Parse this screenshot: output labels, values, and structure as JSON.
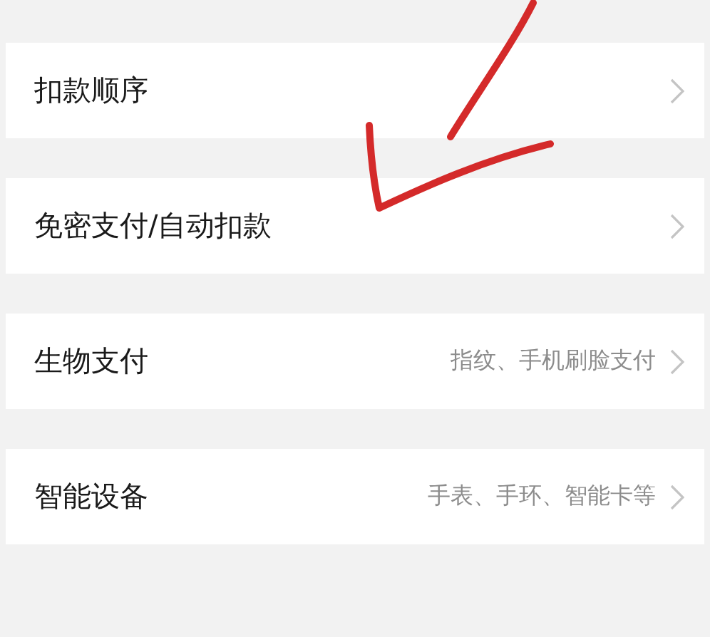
{
  "settings": [
    {
      "label": "扣款顺序"
    },
    {
      "label": "免密支付/自动扣款"
    },
    {
      "label": "生物支付",
      "detail": "指纹、手机刷脸支付"
    },
    {
      "label": "智能设备",
      "detail": "手表、手环、智能卡等"
    }
  ],
  "annotation": {
    "kind": "arrow"
  }
}
